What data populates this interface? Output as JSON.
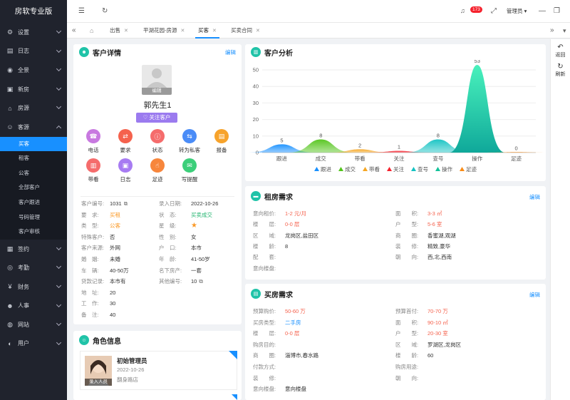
{
  "app": {
    "title": "房软专业版"
  },
  "sidebar": {
    "items": [
      {
        "label": "设置",
        "icon": "gear-icon",
        "glyph": "⚙"
      },
      {
        "label": "日志",
        "icon": "calendar-icon",
        "glyph": "▤"
      },
      {
        "label": "全景",
        "icon": "compass-icon",
        "glyph": "◉"
      },
      {
        "label": "新房",
        "icon": "briefcase-icon",
        "glyph": "▣"
      },
      {
        "label": "房源",
        "icon": "house-icon",
        "glyph": "⌂"
      },
      {
        "label": "客源",
        "icon": "people-icon",
        "glyph": "☺"
      }
    ],
    "sub_items": [
      "买客",
      "租客",
      "公客",
      "全部客户",
      "客户跟进",
      "号码管理",
      "客户审核"
    ],
    "items_after": [
      {
        "label": "签约",
        "icon": "document-icon",
        "glyph": "▦"
      },
      {
        "label": "考勤",
        "icon": "location-icon",
        "glyph": "◎"
      },
      {
        "label": "财务",
        "icon": "finance-icon",
        "glyph": "¥"
      },
      {
        "label": "人事",
        "icon": "person-icon",
        "glyph": "☻"
      },
      {
        "label": "网站",
        "icon": "globe-icon",
        "glyph": "◍"
      },
      {
        "label": "用户",
        "icon": "user-icon",
        "glyph": "◐"
      }
    ]
  },
  "topbar": {
    "notification_count": "173",
    "user": "管理员"
  },
  "tabs": [
    "出售",
    "平湖花园-房源",
    "买客",
    "买卖合同"
  ],
  "customer": {
    "header": "客户详情",
    "edit": "编辑",
    "avatar_caption": "编辑",
    "name": "郭先生1",
    "follow_button": "关注客户",
    "actions": [
      {
        "label": "电话",
        "color": "#c879e0",
        "glyph": "☎"
      },
      {
        "label": "要求",
        "color": "#f5624d",
        "glyph": "⇄"
      },
      {
        "label": "状态",
        "color": "#f56c6c",
        "glyph": "ⓘ"
      },
      {
        "label": "转为私客",
        "color": "#4a8cf7",
        "glyph": "⇆"
      },
      {
        "label": "报备",
        "color": "#f7a32b",
        "glyph": "▤"
      },
      {
        "label": "带看",
        "color": "#f56c6c",
        "glyph": "▥"
      },
      {
        "label": "日志",
        "color": "#a77bf2",
        "glyph": "▣"
      },
      {
        "label": "足迹",
        "color": "#f7863c",
        "glyph": "☝"
      },
      {
        "label": "写提醒",
        "color": "#3ccf7a",
        "glyph": "✉"
      }
    ],
    "fields_left": [
      {
        "k": "客户编号:",
        "v": "1031"
      },
      {
        "k": "要　求:",
        "v": "买租"
      },
      {
        "k": "类　型:",
        "v": "公客"
      },
      {
        "k": "特殊客户:",
        "v": "否"
      },
      {
        "k": "客户来源:",
        "v": "外网"
      },
      {
        "k": "婚　姻:",
        "v": "未婚"
      },
      {
        "k": "车　辆:",
        "v": "40-50万"
      },
      {
        "k": "贷款记录:",
        "v": "本市有"
      },
      {
        "k": "地　址:",
        "v": "20"
      },
      {
        "k": "工　作:",
        "v": "30"
      },
      {
        "k": "备　注:",
        "v": "40"
      }
    ],
    "fields_right": [
      {
        "k": "录入日期:",
        "v": "2022-10-26"
      },
      {
        "k": "状　态:",
        "v": "买卖成交"
      },
      {
        "k": "星　级:",
        "v": "★"
      },
      {
        "k": "性　别:",
        "v": "女"
      },
      {
        "k": "户　口:",
        "v": "本市"
      },
      {
        "k": "年　龄:",
        "v": "41-50岁"
      },
      {
        "k": "名下房产:",
        "v": "一套"
      },
      {
        "k": "其他编号:",
        "v": "10"
      }
    ]
  },
  "role": {
    "header": "角色信息",
    "name": "初始管理员",
    "date": "2022-10-26",
    "store": "翻身路店",
    "tag": "录入人员"
  },
  "analysis": {
    "header": "客户分析"
  },
  "chart_data": {
    "type": "area",
    "categories": [
      "跟进",
      "成交",
      "带看",
      "关注",
      "查号",
      "操作",
      "足迹"
    ],
    "values": [
      5,
      8,
      2,
      1,
      8,
      53,
      0
    ],
    "colors": [
      "#1890ff",
      "#52c41a",
      "#f5a623",
      "#f5222d",
      "#13c2c2",
      "#13c29a",
      "#fa8c16"
    ],
    "ylim": [
      0,
      50
    ],
    "yticks": [
      0,
      10,
      20,
      30,
      40,
      50
    ],
    "grid": true,
    "legend": "bottom"
  },
  "rent": {
    "header": "租房需求",
    "edit": "编辑",
    "rows": [
      {
        "k1": "意向租价:",
        "v1": "1-2 元/月",
        "k2": "面　　积:",
        "v2": "3-3 ㎡"
      },
      {
        "k1": "楼　　层:",
        "v1": "0-0 层",
        "k2": "户　　型:",
        "v2": "5-6 室"
      },
      {
        "k1": "区　　域:",
        "v1": "龙岗区,盐田区",
        "k2": "商　　圈:",
        "v2": "香蜜湖,观湖"
      },
      {
        "k1": "楼　　龄:",
        "v1": "8",
        "k2": "装　　修:",
        "v2": "精致,豪华"
      },
      {
        "k1": "配　　套:",
        "v1": "",
        "k2": "朝　　向:",
        "v2": "西,北,西南"
      },
      {
        "k1": "意向楼盘:",
        "v1": "",
        "k2": "",
        "v2": ""
      }
    ]
  },
  "buy": {
    "header": "买房需求",
    "edit": "编辑",
    "rows": [
      {
        "k1": "预算购价:",
        "v1": "50-60 万",
        "k2": "预算首付:",
        "v2": "70-70 万"
      },
      {
        "k1": "买房类型:",
        "v1": "二手房",
        "k2": "面　　积:",
        "v2": "90-10 ㎡"
      },
      {
        "k1": "楼　　层:",
        "v1": "0-0 层",
        "k2": "户　　型:",
        "v2": "20-30 室"
      },
      {
        "k1": "购房目的:",
        "v1": "",
        "k2": "区　　域:",
        "v2": "罗湖区,龙岗区"
      },
      {
        "k1": "商　　圈:",
        "v1": "淄博市,春水路",
        "k2": "楼　　龄:",
        "v2": "60"
      },
      {
        "k1": "付款方式:",
        "v1": "",
        "k2": "购房用途:",
        "v2": ""
      },
      {
        "k1": "装　　修:",
        "v1": "",
        "k2": "朝　　向:",
        "v2": ""
      },
      {
        "k1": "意向楼盘:",
        "v1": "意向楼盘",
        "k2": "",
        "v2": ""
      }
    ]
  },
  "rightbar": {
    "back": "返回",
    "refresh": "刷新"
  }
}
